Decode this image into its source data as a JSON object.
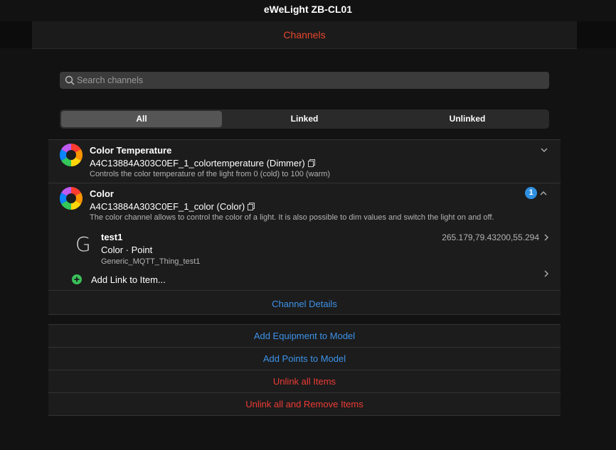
{
  "window": {
    "title": "eWeLight ZB-CL01"
  },
  "navbar": {
    "tab_title": "Channels"
  },
  "search": {
    "placeholder": "Search channels",
    "icon": "search-icon"
  },
  "filter": {
    "tabs": [
      "All",
      "Linked",
      "Unlinked"
    ],
    "active": "All"
  },
  "channels": [
    {
      "label": "Color Temperature",
      "uid": "A4C13884A303C0EF_1_colortemperature (Dimmer)",
      "description": "Controls the color temperature of the light from 0 (cold) to 100 (warm)",
      "expanded": false
    },
    {
      "label": "Color",
      "uid": "A4C13884A303C0EF_1_color (Color)",
      "description": "The color channel allows to control the color of a light. It is also possible to dim values and switch the light on and off.",
      "expanded": true,
      "badge": "1",
      "items": [
        {
          "letter": "G",
          "name": "test1",
          "type": "Color · Point",
          "thing": "Generic_MQTT_Thing_test1",
          "state": "265.179,79.43200,55.294"
        }
      ],
      "add_link_label": "Add Link to Item...",
      "details_label": "Channel Details"
    }
  ],
  "actions": [
    {
      "label": "Add Equipment to Model",
      "color": "#3d92e8"
    },
    {
      "label": "Add Points to Model",
      "color": "#3d92e8"
    },
    {
      "label": "Unlink all Items",
      "color": "#ee3b35"
    },
    {
      "label": "Unlink all and Remove Items",
      "color": "#ee3b35"
    }
  ],
  "colors": {
    "accent": "#e8472c",
    "link": "#3d92e8",
    "danger": "#ee3b35",
    "badge": "#2f8fe0",
    "add": "#3ac15a"
  }
}
